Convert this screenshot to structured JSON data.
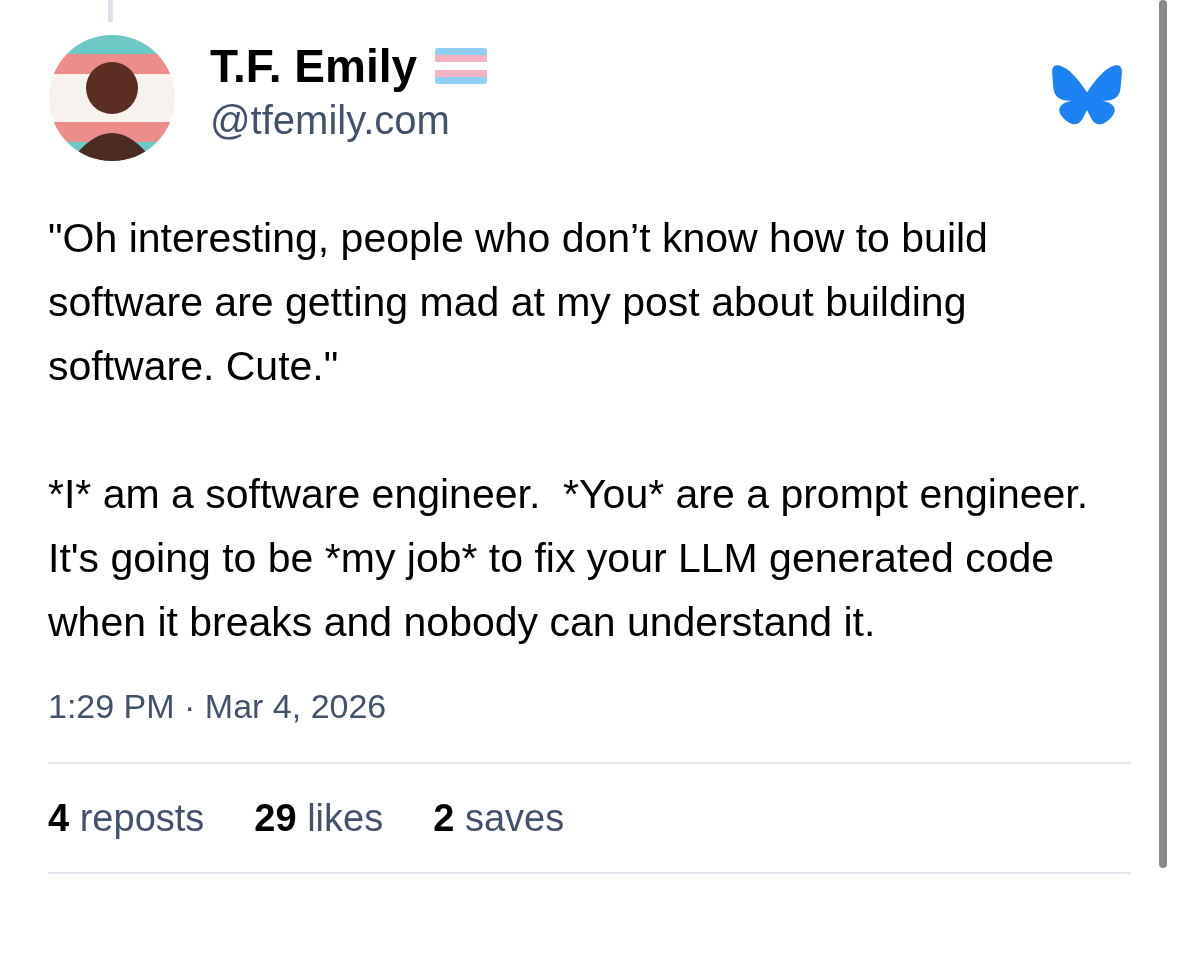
{
  "author": {
    "display_name": "T.F. Emily",
    "handle": "@tfemily.com"
  },
  "post": {
    "paragraphs": [
      "\"Oh interesting, people who don’t know how to build software are getting mad at my post about building software. Cute.\"",
      "*I* am a software engineer.  *You* are a prompt engineer.  It's going to be *my job* to fix your LLM generated code when it breaks and nobody can understand it."
    ],
    "timestamp": "1:29 PM · Mar 4, 2026"
  },
  "stats": [
    {
      "count": "4",
      "label": "reposts"
    },
    {
      "count": "29",
      "label": "likes"
    },
    {
      "count": "2",
      "label": "saves"
    }
  ]
}
